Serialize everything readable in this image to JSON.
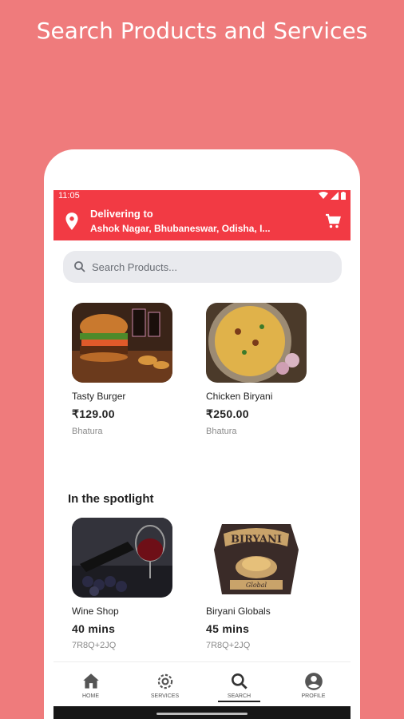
{
  "promo": {
    "headline": "Search Products and Services"
  },
  "statusbar": {
    "time": "11:05"
  },
  "header": {
    "title": "Delivering to",
    "address": "Ashok Nagar, Bhubaneswar, Odisha, I...",
    "accent": "#f23a44"
  },
  "search": {
    "placeholder": "Search Products..."
  },
  "products": [
    {
      "name": "Tasty Burger",
      "price": "₹129.00",
      "category": "Bhatura"
    },
    {
      "name": "Chicken Biryani",
      "price": "₹250.00",
      "category": "Bhatura"
    }
  ],
  "spotlight": {
    "title": "In the spotlight",
    "items": [
      {
        "name": "Wine Shop",
        "time": "40 mins",
        "code": "7R8Q+2JQ"
      },
      {
        "name": "Biryani Globals",
        "time": "45 mins",
        "code": "7R8Q+2JQ",
        "logo_text": "BIRYANI",
        "logo_sub": "Global"
      }
    ]
  },
  "nav": {
    "items": [
      {
        "label": "HOME",
        "icon": "home-icon"
      },
      {
        "label": "SERVICES",
        "icon": "gear-icon"
      },
      {
        "label": "SEARCH",
        "icon": "search-icon"
      },
      {
        "label": "PROFILE",
        "icon": "profile-icon"
      }
    ],
    "active": "SEARCH"
  }
}
